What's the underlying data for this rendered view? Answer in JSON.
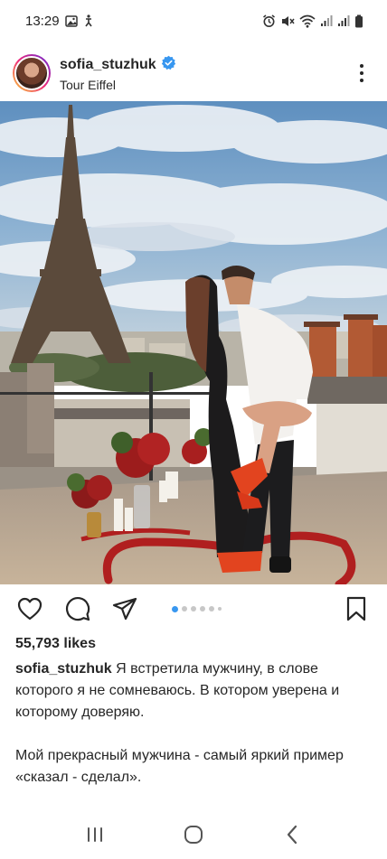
{
  "status_bar": {
    "time": "13:29",
    "left_icons": [
      "gallery-icon",
      "accessibility-icon"
    ],
    "right_icons": [
      "alarm-icon",
      "mute-icon",
      "wifi-icon",
      "signal-icon",
      "signal-2-icon",
      "battery-icon"
    ]
  },
  "post": {
    "username": "sofia_stuzhuk",
    "verified": true,
    "location": "Tour Eiffel",
    "carousel": {
      "current": 1,
      "total": 6
    },
    "likes": "55,793 likes",
    "caption_username": "sofia_stuzhuk",
    "caption_line1": "Я встретила мужчину, в слове которого я не сомневаюсь. В котором уверена и которому доверяю.",
    "caption_line2": "Мой прекрасный мужчина - самый яркий пример «сказал - сделал»."
  },
  "colors": {
    "accent": "#3897f0",
    "verified": "#3897f0",
    "text": "#262626"
  }
}
